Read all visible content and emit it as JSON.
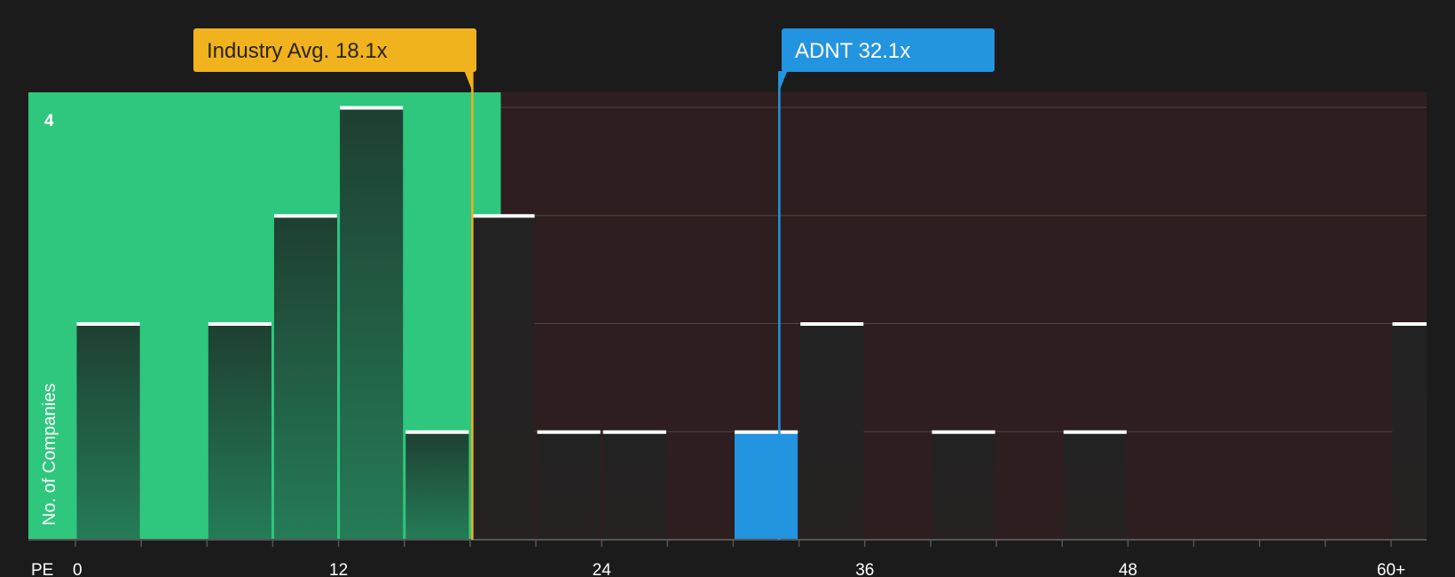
{
  "chart_data": {
    "type": "bar",
    "xlabel": "PE",
    "ylabel": "No. of Companies",
    "x_ticks": [
      "0",
      "12",
      "24",
      "36",
      "48",
      "60+"
    ],
    "x_tick_values": [
      0,
      12,
      24,
      36,
      48,
      60
    ],
    "y_ticks": [
      "4"
    ],
    "y_tick_values": [
      4
    ],
    "xlim": [
      0,
      61.5
    ],
    "ylim": [
      0,
      4.15
    ],
    "bin_width": 3,
    "bars": [
      {
        "x": 0,
        "value": 2
      },
      {
        "x": 6,
        "value": 2
      },
      {
        "x": 9,
        "value": 3
      },
      {
        "x": 12,
        "value": 4
      },
      {
        "x": 15,
        "value": 1
      },
      {
        "x": 18,
        "value": 3
      },
      {
        "x": 21,
        "value": 1
      },
      {
        "x": 24,
        "value": 1
      },
      {
        "x": 30,
        "value": 1,
        "highlight": true
      },
      {
        "x": 33,
        "value": 2
      },
      {
        "x": 39,
        "value": 1
      },
      {
        "x": 45,
        "value": 1
      },
      {
        "x": 60,
        "value": 2
      }
    ],
    "annotations": [
      {
        "label": "Industry Avg. 18.1x",
        "x": 18.1,
        "color": "#f0b21d"
      },
      {
        "label": "ADNT 32.1x",
        "x": 32.1,
        "color": "#2394e0"
      }
    ],
    "fair_threshold": 19.4,
    "grid": true,
    "colors": {
      "background": "#1b1b1b",
      "fair_region": "#2ec77d",
      "high_region": "#2f1e1f",
      "bar_in_fair": "#1f4a36",
      "bar_in_high": "#232021",
      "bar_highlight": "#2394e0",
      "bar_top": "#ffffff",
      "grid": "#4a4444",
      "axis": "#555555"
    }
  }
}
